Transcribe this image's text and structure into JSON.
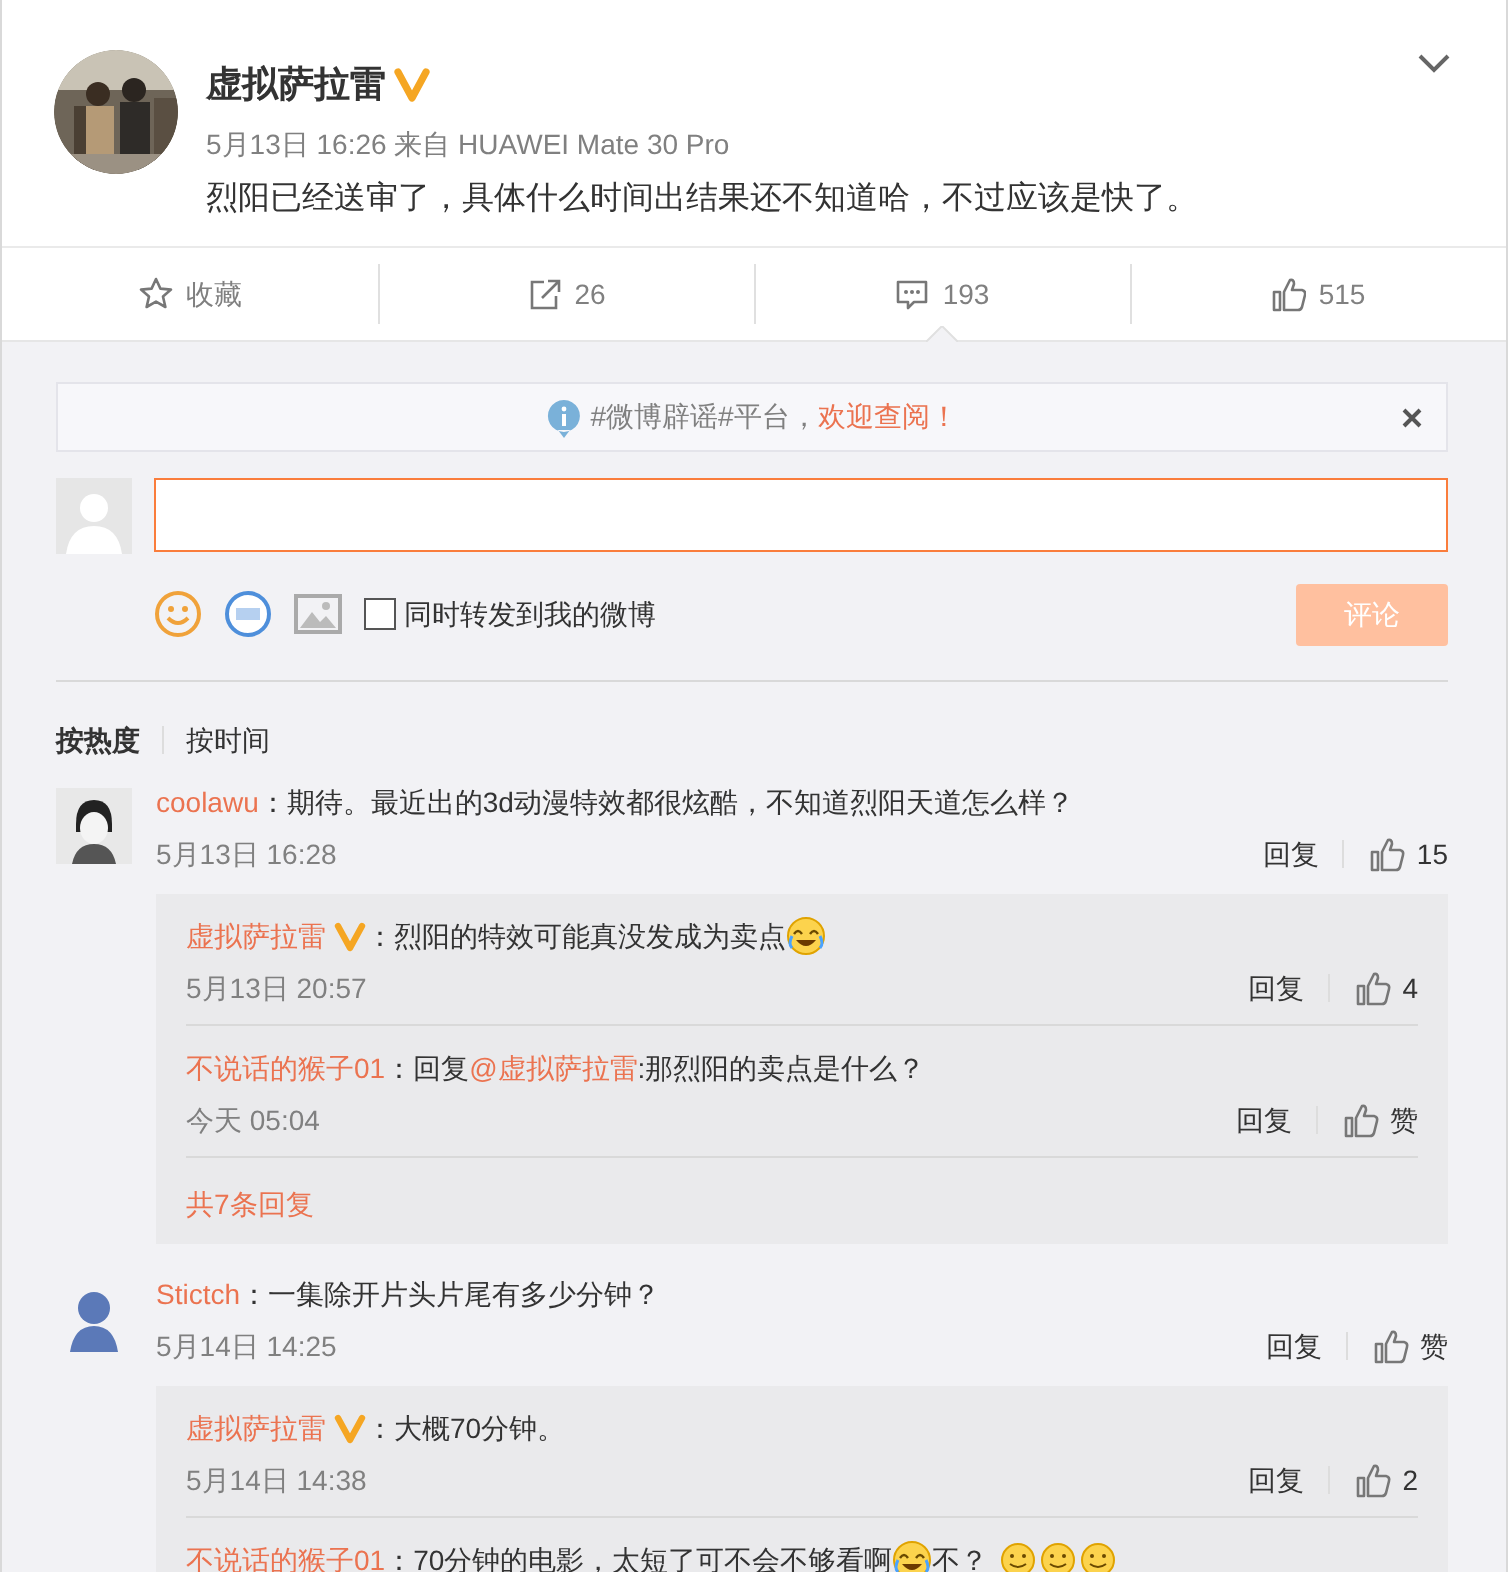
{
  "post": {
    "author": "虚拟萨拉雷",
    "verified": true,
    "meta": "5月13日 16:26 来自 HUAWEI Mate 30 Pro",
    "text": "烈阳已经送审了，具体什么时间出结果还不知道哈，不过应该是快了。"
  },
  "actions": [
    {
      "kind": "favorite",
      "label": "收藏",
      "selected": false
    },
    {
      "kind": "repost",
      "label": "26",
      "selected": false
    },
    {
      "kind": "comment",
      "label": "193",
      "selected": true
    },
    {
      "kind": "like",
      "label": "515",
      "selected": false
    }
  ],
  "notice": {
    "text": "#微博辟谣#平台，",
    "link": "欢迎查阅！"
  },
  "composer": {
    "repost_label": "同时转发到我的微博",
    "repost_checked": false,
    "submit": "评论",
    "submit_disabled": true
  },
  "sort_tabs": [
    {
      "label": "按热度",
      "selected": true
    },
    {
      "label": "按时间",
      "selected": false
    }
  ],
  "comments": [
    {
      "author": "coolawu",
      "verified": false,
      "text": "：期待。最近出的3d动漫特效都很炫酷，不知道烈阳天道怎么样？",
      "time": "5月13日 16:28",
      "reply": "回复",
      "likes": "15",
      "replies": [
        {
          "author": "虚拟萨拉雷",
          "verified": true,
          "text": "：烈阳的特效可能真没发成为卖点",
          "has_emoji": true,
          "time": "5月13日 20:57",
          "reply": "回复",
          "likes": "4"
        },
        {
          "author": "不说话的猴子01",
          "verified": false,
          "reply_prefix": "：回复",
          "mention": "@虚拟萨拉雷",
          "text": ":那烈阳的卖点是什么？",
          "has_emoji": false,
          "time": "今天 05:04",
          "reply": "回复",
          "likes": "赞"
        }
      ],
      "more": "共7条回复"
    },
    {
      "author": "Stictch",
      "verified": false,
      "text": "：一集除开片头片尾有多少分钟？",
      "time": "5月14日 14:25",
      "reply": "回复",
      "likes": "赞",
      "replies": [
        {
          "author": "虚拟萨拉雷",
          "verified": true,
          "text": "：大概70分钟。",
          "has_emoji": false,
          "time": "5月14日 14:38",
          "reply": "回复",
          "likes": "2"
        },
        {
          "author": "不说话的猴子01",
          "verified": false,
          "text": "：70分钟的电影，太短了可不会不够看啊",
          "has_emoji": true,
          "tail": "不？",
          "trailing_emojis": true
        }
      ]
    }
  ]
}
